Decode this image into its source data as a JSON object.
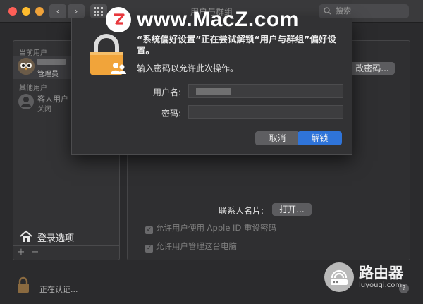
{
  "window": {
    "title": "用户与群组",
    "search_placeholder": "搜索",
    "back_icon": "chevron-left-icon",
    "forward_icon": "chevron-right-icon"
  },
  "watermark": {
    "text": "www.MacZ.com",
    "logo_letter": "Z",
    "logo_color": "#e8383d"
  },
  "sidebar": {
    "current_users_label": "当前用户",
    "current_user": {
      "role": "管理员"
    },
    "other_users_label": "其他用户",
    "guest_user": {
      "name": "客人用户",
      "status": "关闭"
    },
    "login_options_label": "登录选项",
    "add_label": "+",
    "remove_label": "−"
  },
  "main": {
    "change_password_label": "改密码...",
    "contact_card_label": "联系人名片:",
    "open_button_label": "打开...",
    "checkbox_apple_id": "允许用户使用 Apple ID 重设密码",
    "checkbox_admin": "允许用户管理这台电脑"
  },
  "dialog": {
    "title": "“系统偏好设置”正在尝试解锁“用户与群组”偏好设置。",
    "message": "输入密码以允许此次操作。",
    "username_label": "用户名:",
    "password_label": "密码:",
    "cancel_label": "取消",
    "unlock_label": "解锁"
  },
  "status": {
    "authenticating": "正在认证..."
  },
  "brand": {
    "name_cn": "路由器",
    "name_en": "luyouqi.com"
  },
  "colors": {
    "accent": "#2f74d9",
    "lock_orange": "#f1a43a",
    "close": "#ff5f57",
    "minimize": "#febc2e"
  }
}
